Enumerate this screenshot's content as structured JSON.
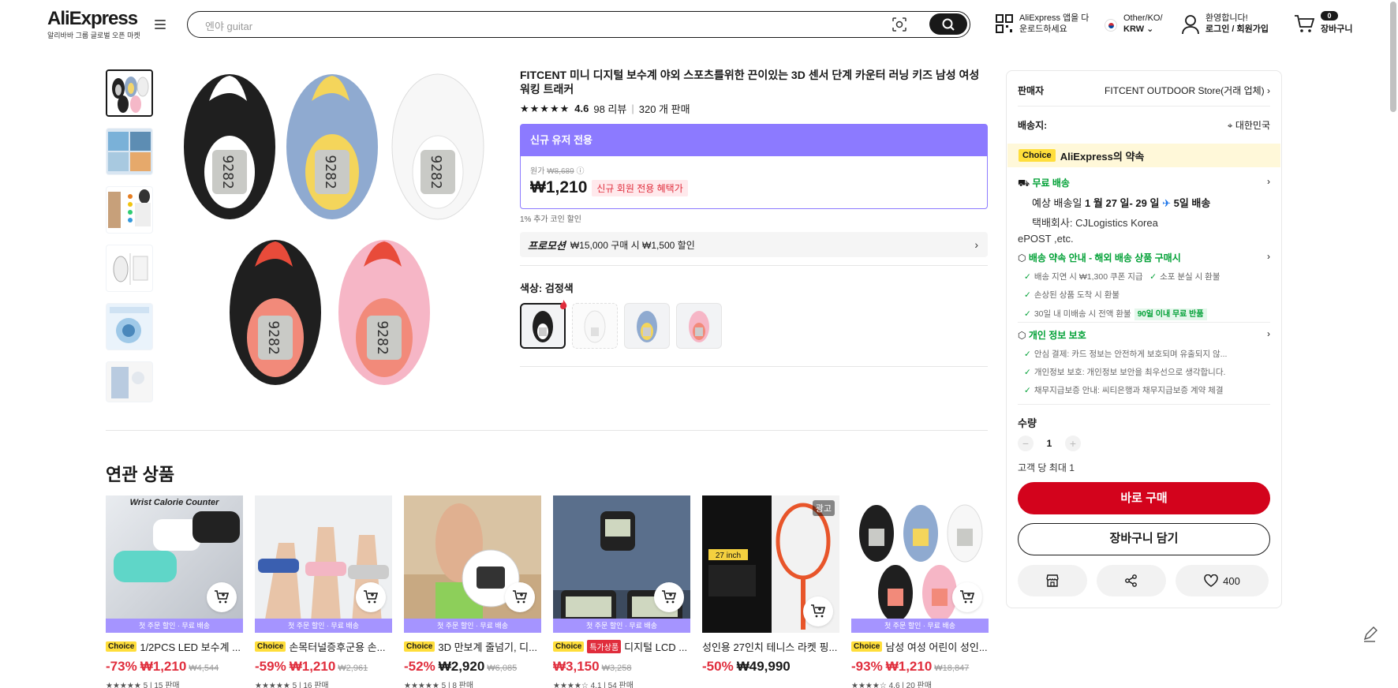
{
  "header": {
    "logo": "AliExpress",
    "logo_sub": "알리바바 그룹 글로벌 오픈 마켓",
    "search_placeholder": "엔야 guitar",
    "app_line1": "AliExpress 앱을 다",
    "app_line2": "운로드하세요",
    "lang_line1": "Other/KO/",
    "lang_line2": "KRW",
    "acct_line1": "환영합니다!",
    "acct_line2": "로그인 / 회원가입",
    "cart_count": "0",
    "cart_label": "장바구니"
  },
  "product": {
    "title": "FITCENT 미니 디지털 보수계 야외 스포츠를위한 끈이있는 3D 센서 단계 카운터 러닝 키즈 남성 여성 워킹 트래커",
    "stars": "★★★★★",
    "rating": "4.6",
    "reviews": "98 리뷰",
    "sold": "320 개 판매",
    "promo_head": "신규 유저 전용",
    "orig_label": "원가",
    "orig_price": "₩8,689",
    "price": "₩1,210",
    "new_badge": "신규 회원 전용 혜택가",
    "coin": "1% 추가 코인 할인",
    "promotion_label": "프로모션",
    "promotion_text": "₩15,000 구매 시 ₩1,500 할인",
    "color_label": "색상: 검정색"
  },
  "related": {
    "title": "연관 상품",
    "ribbon": "첫 주문 할인 · 무료 배송",
    "ad": "광고",
    "items": [
      {
        "choice": "Choice",
        "name": "1/2PCS LED 보수계 ...",
        "disc": "-73%",
        "price": "₩1,210",
        "orig": "₩4,544",
        "meta": "★★★★★ 5 | 15 판매"
      },
      {
        "choice": "Choice",
        "name": "손목터널증후군용 손...",
        "disc": "-59%",
        "price": "₩1,210",
        "orig": "₩2,961",
        "meta": "★★★★★ 5 | 16 판매"
      },
      {
        "choice": "Choice",
        "name": "3D 만보계 줄넘기, 디...",
        "disc": "-52%",
        "price": "₩2,920",
        "orig": "₩6,085",
        "meta": "★★★★★ 5 | 8 판매"
      },
      {
        "choice": "Choice",
        "special": "특가상품",
        "name": "디지털 LCD ...",
        "disc": "",
        "price": "₩3,150",
        "orig": "₩3,258",
        "meta": "★★★★☆ 4.1 | 54 판매"
      },
      {
        "choice": "",
        "name": "성인용 27인치 테니스 라켓 핑...",
        "disc": "-50%",
        "price": "₩49,990",
        "orig": "",
        "meta": ""
      },
      {
        "choice": "Choice",
        "name": "남성 여성 어린이 성인...",
        "disc": "-93%",
        "price": "₩1,210",
        "orig": "₩18,847",
        "meta": "★★★★☆ 4.6 | 20 판매"
      }
    ]
  },
  "panel": {
    "seller_label": "판매자",
    "seller_name": "FITCENT OUTDOOR Store(거래 업체)",
    "ship_to_label": "배송지:",
    "ship_to": "대한민국",
    "choice_pill": "Choice",
    "choice_text": "AliExpress의 약속",
    "free_ship": "무료 배송",
    "eta_prefix": "예상 배송일",
    "eta_dates": "1 월 27 일- 29 일",
    "eta_days": "5일 배송",
    "carrier_line1": "택배회사:  CJLogistics  Korea",
    "carrier_line2": "ePOST ,etc.",
    "promise_title": "배송 약속 안내 - 해외 배송 상품 구매시",
    "promise_1a": "배송 지연 시 ₩1,300 쿠폰 지급",
    "promise_1b": "소포 분실 시 환불",
    "promise_2": "손상된 상품 도착 시 환불",
    "promise_3": "30일 내 미배송 시 전액 환불",
    "promise_3_pill": "90일 이내 무료 반품",
    "privacy_title": "개인 정보 보호",
    "privacy_1": "안심 결제: 카드 정보는 안전하게 보호되며 유출되지 않...",
    "privacy_2": "개인정보 보호: 개인정보 보안을 최우선으로 생각합니다.",
    "privacy_3": "채무지급보증 안내: 씨티은행과 채무지급보증 계약 체결",
    "qty_label": "수량",
    "qty_value": "1",
    "limit": "고객 당 최대 1",
    "buy_now": "바로 구매",
    "add_cart": "장바구니 담기",
    "wish_count": "400"
  }
}
